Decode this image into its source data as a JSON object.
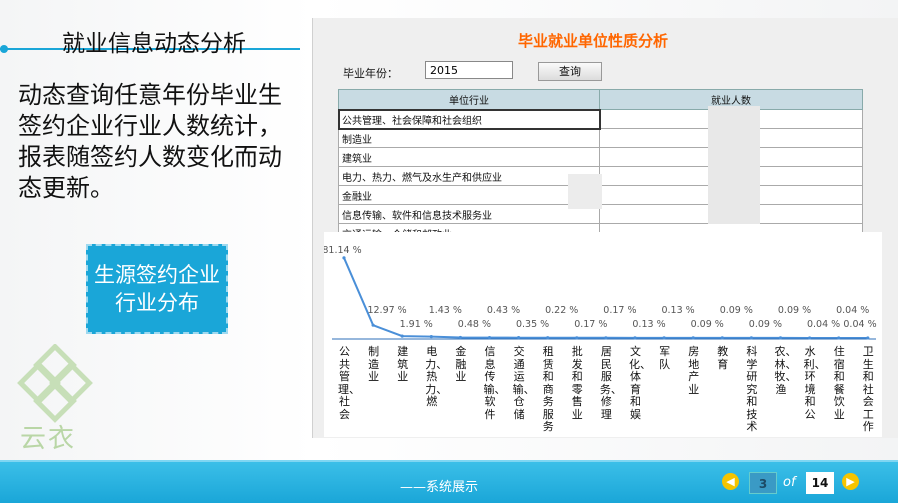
{
  "slide": {
    "title": "就业信息动态分析",
    "description": "动态查询任意年份毕业生签约企业行业人数统计，报表随签约人数变化而动态更新。",
    "tag": "生源签约企业行业分布",
    "logo_text": "云衣"
  },
  "app": {
    "title": "毕业就业单位性质分析",
    "year_label": "毕业年份：",
    "year_value": "2015",
    "query_label": "查询",
    "table": {
      "headers": [
        "单位行业",
        "就业人数"
      ],
      "rows": [
        "公共管理、社会保障和社会组织",
        "制造业",
        "建筑业",
        "电力、热力、燃气及水生产和供应业",
        "金融业",
        "信息传输、软件和信息技术服务业",
        "交通运输、仓储和邮政业"
      ]
    }
  },
  "chart_data": {
    "type": "line",
    "categories": [
      "公共管理、社会",
      "制造业",
      "建筑业",
      "电力、热力、燃",
      "金融业",
      "信息传输、软件",
      "交通运输、仓储",
      "租赁和商务服务",
      "批发和零售业",
      "居民服务、修理",
      "文化、体育和娱",
      "军队",
      "房地产业",
      "教育",
      "科学研究和技术",
      "农、林、牧、渔",
      "水利、环境和公",
      "住宿和餐饮业",
      "卫生和社会工作"
    ],
    "values": [
      81.14,
      12.97,
      1.91,
      1.43,
      0.48,
      0.43,
      0.35,
      0.22,
      0.17,
      0.17,
      0.13,
      0.13,
      0.09,
      0.09,
      0.09,
      0.09,
      0.04,
      0.04,
      0.04
    ],
    "labels": [
      "81.14 %",
      "12.97 %",
      "1.91 %",
      "1.43 %",
      "0.48 %",
      "0.43 %",
      "0.35 %",
      "0.22 %",
      "0.17 %",
      "0.17 %",
      "0.13 %",
      "0.13 %",
      "0.09 %",
      "0.09 %",
      "0.09 %",
      "0.09 %",
      "0.04 %",
      "0.04 %",
      "0.04 %"
    ],
    "ylim": [
      0,
      85
    ],
    "line_color": "#4a8fd8"
  },
  "footer": {
    "caption": "——系统展示",
    "prev_icon": "chevron-left-icon",
    "next_icon": "chevron-right-icon",
    "page_current": "3",
    "page_of": "of",
    "page_total": "14"
  }
}
